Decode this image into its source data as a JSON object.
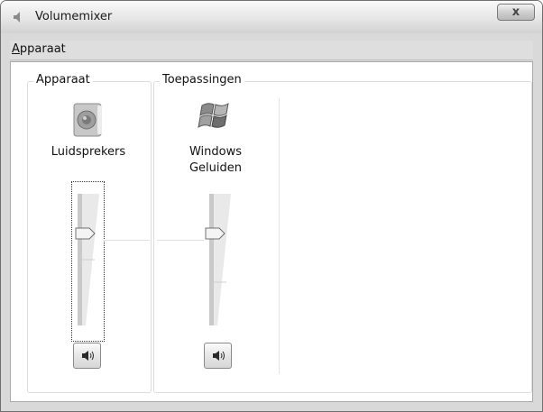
{
  "window": {
    "title": "Volumemixer",
    "close_symbol": "x"
  },
  "menu": {
    "items": [
      {
        "label": "Apparaat"
      }
    ]
  },
  "device_group": {
    "label": "Apparaat",
    "device_name": "Luidsprekers",
    "icon": "speaker-icon",
    "volume_level": 0.7,
    "muted": false
  },
  "apps_group": {
    "label": "Toepassingen",
    "apps": [
      {
        "name_line1": "Windows",
        "name_line2": "Geluiden",
        "icon": "windows-logo-icon",
        "volume_level": 0.7,
        "muted": false
      }
    ]
  },
  "colors": {
    "titlebar": "#e6e6e6",
    "frame": "#d9d9d9",
    "content_bg": "#ffffff"
  }
}
